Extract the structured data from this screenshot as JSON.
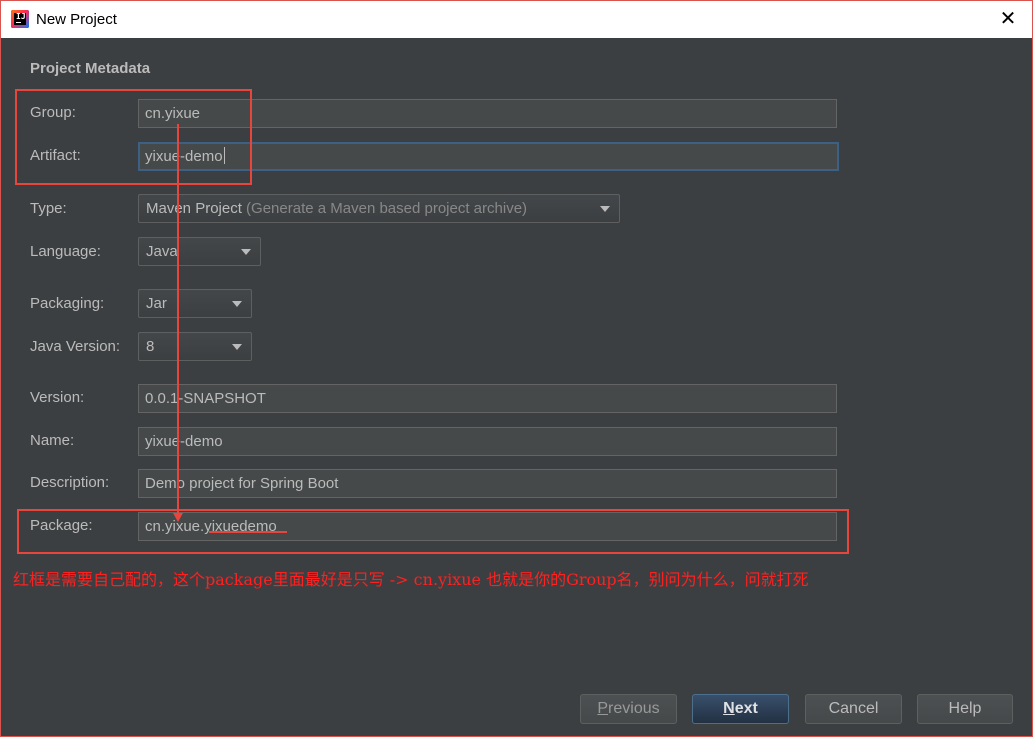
{
  "window": {
    "title": "New Project"
  },
  "section_title": "Project Metadata",
  "labels": {
    "group": "Group:",
    "artifact": "Artifact:",
    "type": "Type:",
    "language": "Language:",
    "packaging": "Packaging:",
    "java_version": "Java Version:",
    "version": "Version:",
    "name": "Name:",
    "description": "Description:",
    "package": "Package:"
  },
  "values": {
    "group": "cn.yixue",
    "artifact": "yixue-demo",
    "type_main": "Maven Project",
    "type_hint": "(Generate a Maven based project archive)",
    "language": "Java",
    "packaging": "Jar",
    "java_version": "8",
    "version": "0.0.1-SNAPSHOT",
    "name": "yixue-demo",
    "description": "Demo project for Spring Boot",
    "package": "cn.yixue.yixuedemo"
  },
  "annotation": "红框是需要自己配的，这个package里面最好是只写 ->  cn.yixue 也就是你的Group名，别问为什么，问就打死",
  "buttons": {
    "previous_mnemonic": "P",
    "previous_rest": "revious",
    "next_mnemonic": "N",
    "next_rest": "ext",
    "cancel": "Cancel",
    "help": "Help"
  },
  "colors": {
    "background": "#3c3f41",
    "annotation_red": "#e8453c",
    "focus_border": "#3d6185",
    "primary_button": "#365880"
  },
  "icons": {
    "app": "intellij-idea-icon",
    "close": "close-icon",
    "dropdown": "chevron-down-icon"
  }
}
